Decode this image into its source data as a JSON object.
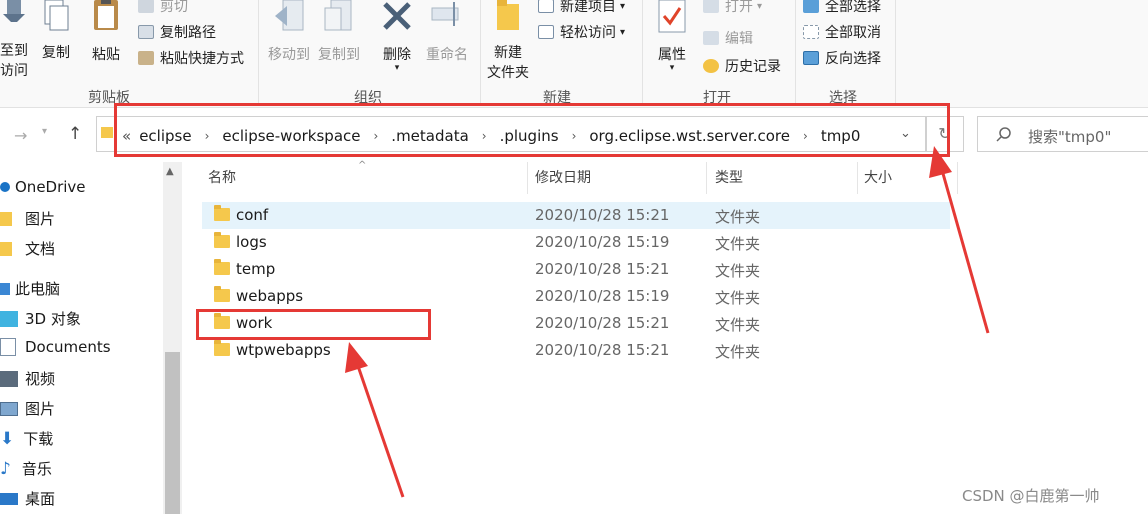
{
  "ribbon": {
    "clipboard": {
      "label": "剪贴板",
      "pin_label_1": "至到",
      "pin_label_2": "访问",
      "copy": "复制",
      "paste": "粘贴",
      "cut": "剪切",
      "copy_path": "复制路径",
      "paste_shortcut": "粘贴快捷方式"
    },
    "organize": {
      "label": "组织",
      "move_to": "移动到",
      "copy_to": "复制到",
      "delete": "删除",
      "rename": "重命名"
    },
    "new": {
      "label": "新建",
      "new_folder_1": "新建",
      "new_folder_2": "文件夹",
      "new_item": "新建项目",
      "easy_access": "轻松访问"
    },
    "open": {
      "label": "打开",
      "properties": "属性",
      "open": "打开",
      "edit": "编辑",
      "history": "历史记录"
    },
    "select": {
      "label": "选择",
      "select_all": "全部选择",
      "select_none": "全部取消",
      "invert": "反向选择"
    }
  },
  "address": {
    "prefix": "«",
    "crumbs": [
      "eclipse",
      "eclipse-workspace",
      ".metadata",
      ".plugins",
      "org.eclipse.wst.server.core",
      "tmp0"
    ]
  },
  "search": {
    "placeholder": "搜索\"tmp0\""
  },
  "nav": {
    "items": [
      "OneDrive",
      "图片",
      "文档",
      "此电脑",
      "3D 对象",
      "Documents",
      "视频",
      "图片",
      "下载",
      "音乐",
      "桌面"
    ]
  },
  "columns": {
    "name": "名称",
    "modified": "修改日期",
    "type": "类型",
    "size": "大小"
  },
  "files": [
    {
      "name": "conf",
      "date": "2020/10/28 15:21",
      "type": "文件夹"
    },
    {
      "name": "logs",
      "date": "2020/10/28 15:19",
      "type": "文件夹"
    },
    {
      "name": "temp",
      "date": "2020/10/28 15:21",
      "type": "文件夹"
    },
    {
      "name": "webapps",
      "date": "2020/10/28 15:19",
      "type": "文件夹"
    },
    {
      "name": "work",
      "date": "2020/10/28 15:21",
      "type": "文件夹"
    },
    {
      "name": "wtpwebapps",
      "date": "2020/10/28 15:21",
      "type": "文件夹"
    }
  ],
  "watermark": "CSDN @白鹿第一帅",
  "colors": {
    "annotation": "#e53935",
    "selection": "#e5f3fb",
    "folder": "#f5c84c"
  }
}
